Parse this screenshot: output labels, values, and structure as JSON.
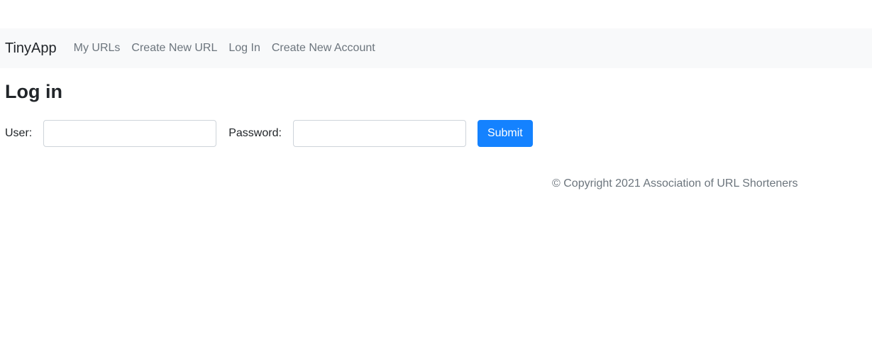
{
  "navbar": {
    "brand": "TinyApp",
    "links": [
      {
        "label": "My URLs"
      },
      {
        "label": "Create New URL"
      },
      {
        "label": "Log In"
      },
      {
        "label": "Create New Account"
      }
    ]
  },
  "main": {
    "title": "Log in",
    "form": {
      "user_label": "User:",
      "user_value": "",
      "password_label": "Password:",
      "password_value": "",
      "submit_label": "Submit"
    }
  },
  "footer": {
    "text": "© Copyright 2021 Association of URL Shorteners"
  },
  "colors": {
    "navbar_bg": "#f8f9fa",
    "submit_bg": "#1482ff",
    "muted_text": "#6c757d"
  }
}
